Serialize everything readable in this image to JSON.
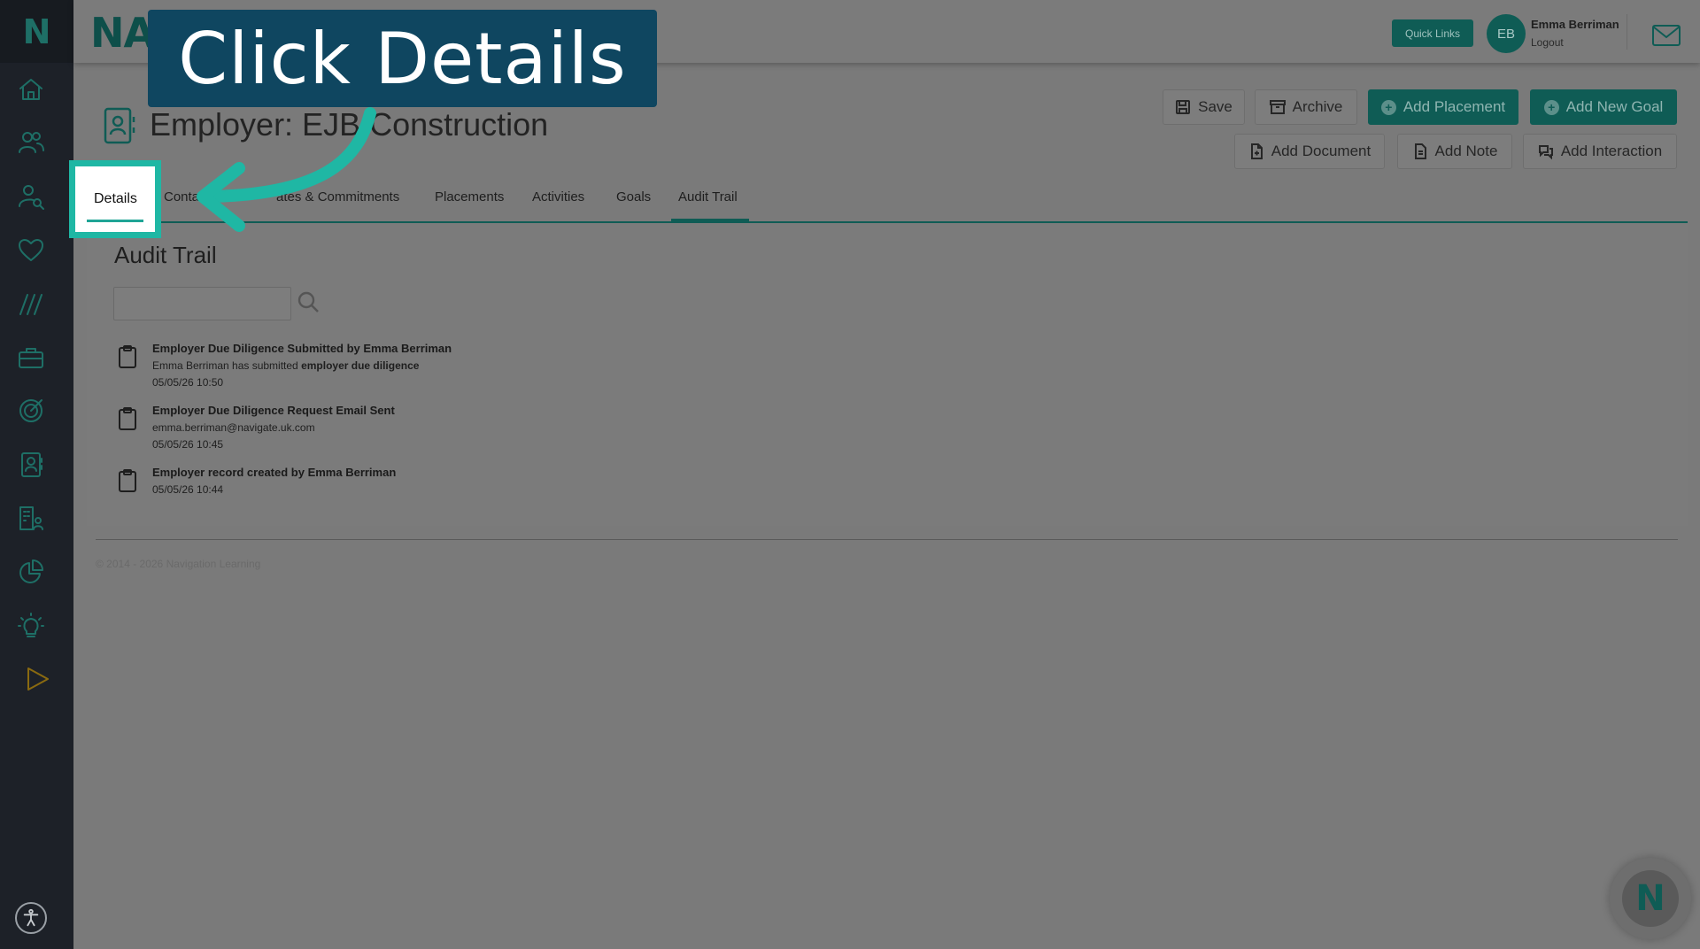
{
  "sidebar": {
    "logo": "N",
    "items": [
      {
        "icon": "home-icon"
      },
      {
        "icon": "people-icon"
      },
      {
        "icon": "person-search-icon"
      },
      {
        "icon": "heart-icon"
      },
      {
        "icon": "slashes-icon"
      },
      {
        "icon": "briefcase-icon"
      },
      {
        "icon": "target-icon"
      },
      {
        "icon": "contact-card-icon"
      },
      {
        "icon": "building-person-icon"
      },
      {
        "icon": "pie-chart-icon"
      },
      {
        "icon": "lightbulb-icon"
      },
      {
        "icon": "play-icon"
      }
    ],
    "accessibility_icon": "accessibility-icon"
  },
  "header": {
    "brand": "NAV",
    "quick_links": "Quick Links",
    "user_initials": "EB",
    "user_name": "Emma Berriman",
    "logout": "Logout",
    "mail_icon": "mail-icon"
  },
  "page": {
    "title": "Employer: EJB Construction"
  },
  "actions": {
    "save": "Save",
    "archive": "Archive",
    "add_placement": "Add Placement",
    "add_new_goal": "Add New Goal",
    "add_document": "Add Document",
    "add_note": "Add Note",
    "add_interaction": "Add Interaction"
  },
  "tabs": {
    "details": "Details",
    "contacts": "Conta",
    "vacancies": "ates & Commitments",
    "placements": "Placements",
    "activities": "Activities",
    "goals": "Goals",
    "audit_trail": "Audit Trail"
  },
  "audit": {
    "section_title": "Audit Trail",
    "search_value": "",
    "entries": [
      {
        "title": "Employer Due Diligence Submitted by Emma Berriman",
        "desc_prefix": "Emma Berriman has submitted ",
        "desc_bold": "employer due diligence",
        "time": "05/05/26 10:50"
      },
      {
        "title": "Employer Due Diligence Request Email Sent",
        "desc_prefix": "emma.berriman@navigate.uk.com",
        "desc_bold": "",
        "time": "05/05/26 10:45"
      },
      {
        "title": "Employer record created by Emma Berriman",
        "desc_prefix": "",
        "desc_bold": "",
        "time": "05/05/26 10:44"
      }
    ]
  },
  "footer": {
    "copyright": "© 2014 - 2026 Navigation Learning"
  },
  "overlay": {
    "callout": "Click Details"
  },
  "colors": {
    "brand_teal": "#0f5c55",
    "highlight": "#1fb7a4",
    "callout_bg": "#0f4660",
    "sidebar_bg": "#1d2128"
  }
}
